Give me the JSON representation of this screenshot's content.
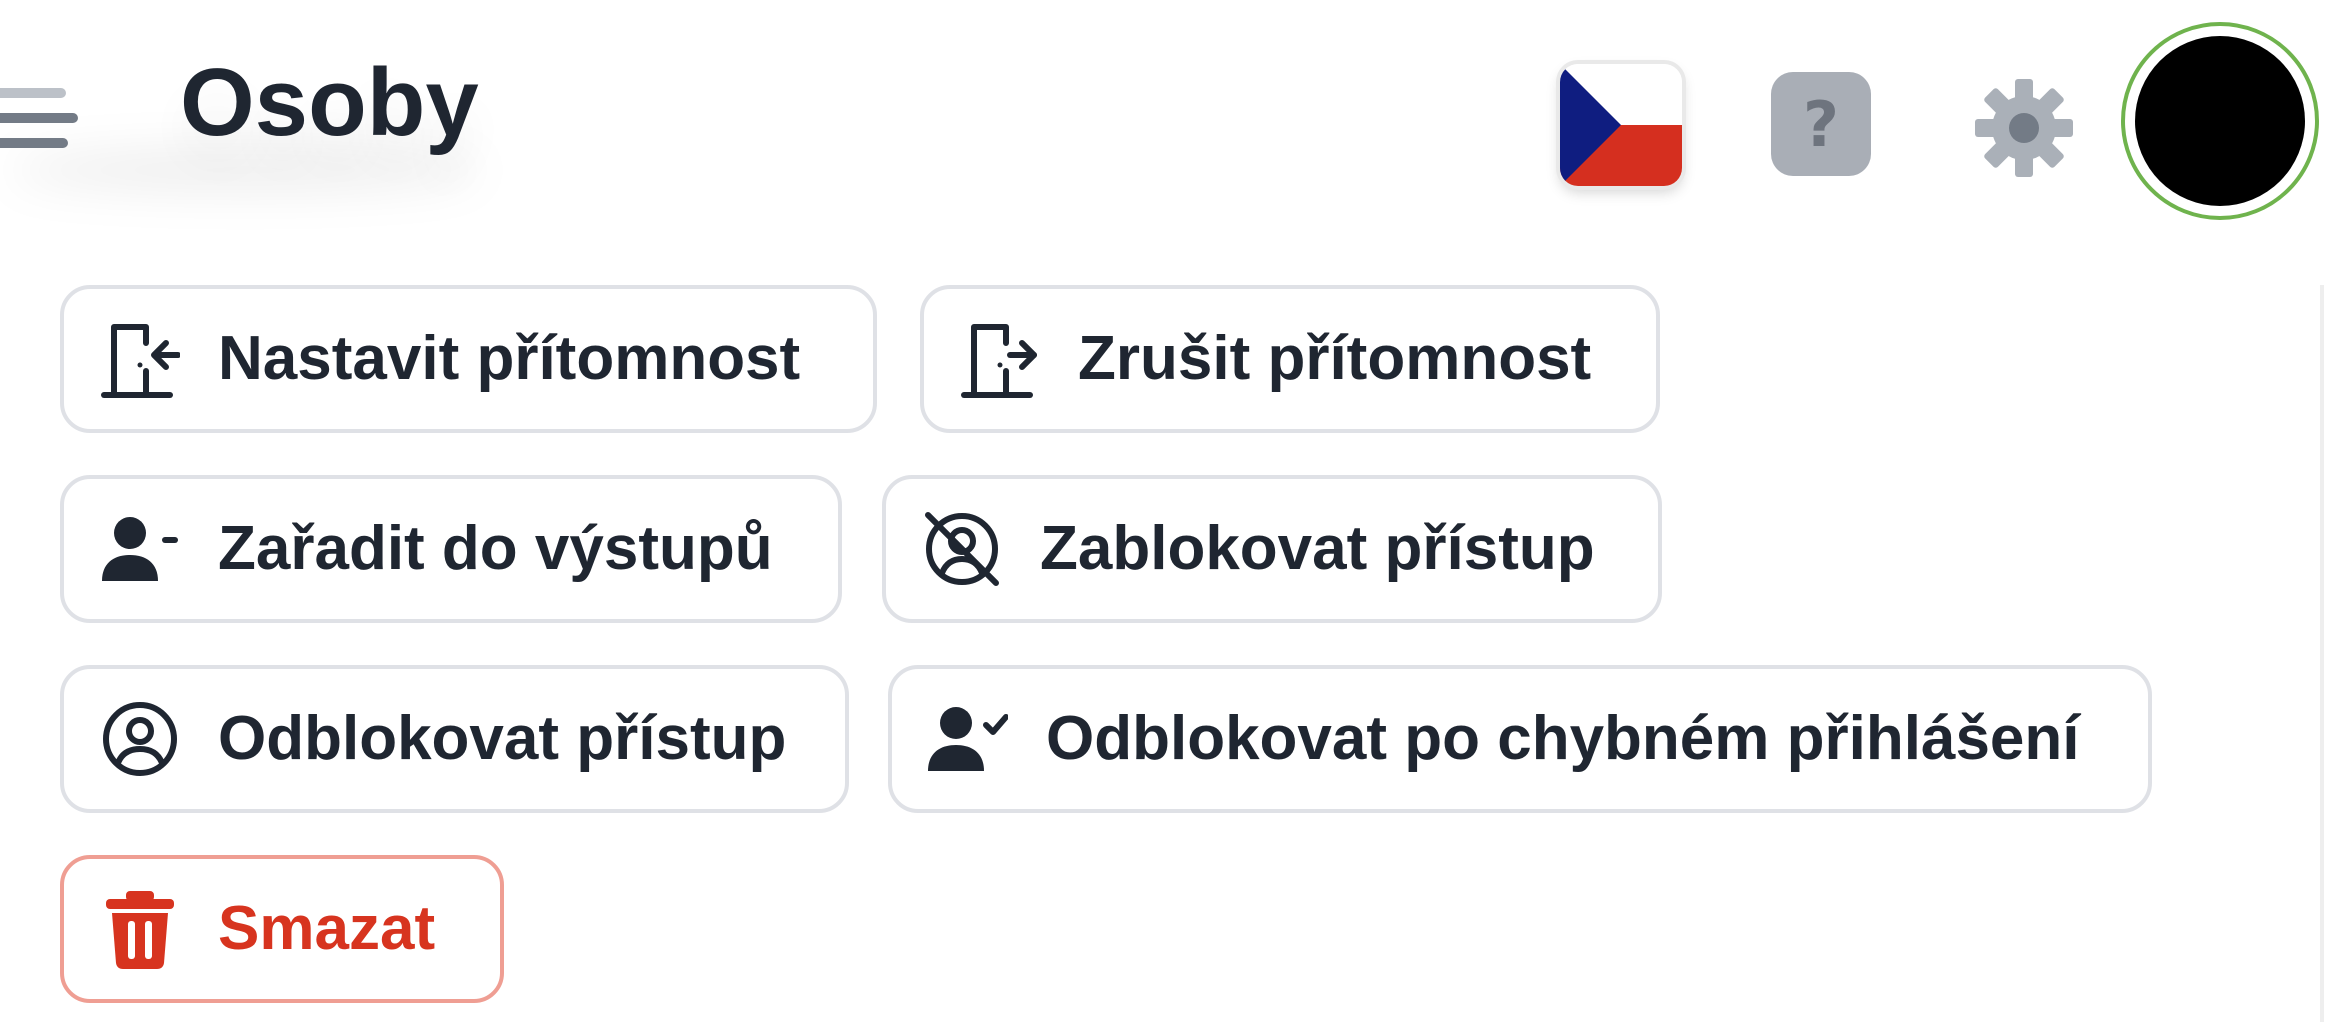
{
  "header": {
    "title": "Osoby",
    "menu_icon": "hamburger-menu-icon",
    "language": {
      "icon": "czech-flag-icon"
    },
    "help": {
      "symbol": "?",
      "icon": "help-icon"
    },
    "settings": {
      "icon": "gear-icon"
    },
    "avatar": {
      "icon": "avatar-icon",
      "ring_color": "#6fb34d"
    }
  },
  "actions": [
    {
      "label": "Nastavit přítomnost",
      "icon": "door-enter-icon"
    },
    {
      "label": "Zrušit přítomnost",
      "icon": "door-exit-icon"
    },
    {
      "label": "Zařadit do výstupů",
      "icon": "user-minus-icon"
    },
    {
      "label": "Zablokovat přístup",
      "icon": "blocked-user-icon"
    },
    {
      "label": "Odblokovat přístup",
      "icon": "user-circle-icon"
    },
    {
      "label": "Odblokovat po chybném přihlášení",
      "icon": "user-check-icon"
    },
    {
      "label": "Smazat",
      "icon": "trash-icon"
    }
  ],
  "colors": {
    "text_primary": "#1f2631",
    "button_border": "#dfe1e6",
    "danger": "#d7341f",
    "danger_border": "#ef9e93",
    "help_bg": "#a9aeb6",
    "settings_gear": "#aab0b8",
    "avatar_ring": "#6fb34d"
  }
}
